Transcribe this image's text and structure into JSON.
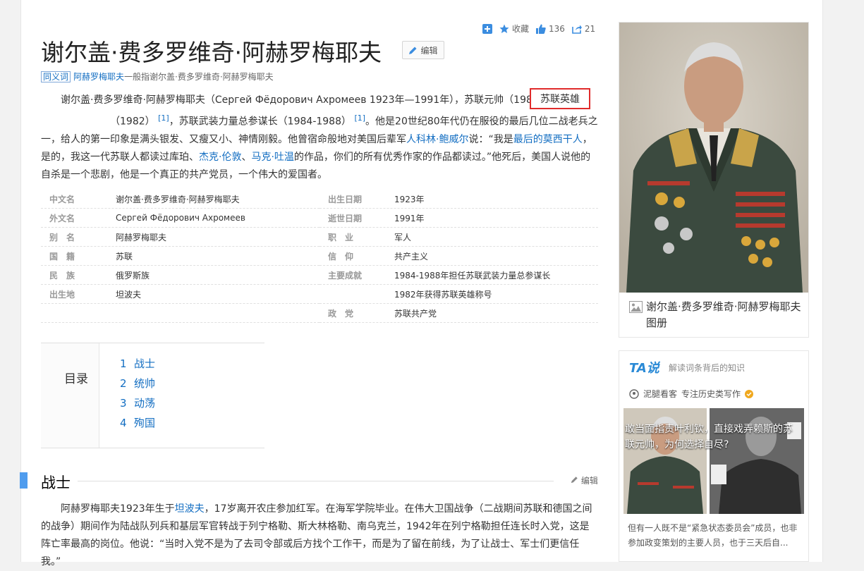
{
  "article": {
    "title": "谢尔盖·费多罗维奇·阿赫罗梅耶夫",
    "edit_label": "编辑",
    "toolbar": {
      "add": "",
      "favorite": "收藏",
      "like_count": "136",
      "share_count": "21"
    },
    "sense": {
      "tag": "同义词",
      "alias": "阿赫罗梅耶夫",
      "text": "一般指谢尔盖·费多罗维奇·阿赫罗梅耶夫"
    },
    "summary": {
      "p1_a": "谢尔盖·费多罗维奇·阿赫罗梅耶夫（Сергей Фёдорович Ахромеев 1923年—1991年），苏联元帅（1983）",
      "highlight": "苏联英雄",
      "p1_b": "（1982）",
      "ref1": "[1]",
      "p1_c": "，苏联武装力量总参谋长（1984-1988）",
      "ref2": "[1]",
      "p1_d": "。他是20世纪80年代仍在服役的最后几位二战老兵之一，给人的第一印象是满头银发、又瘦又小、神情刚毅。他曾宿命般地对美国后辈军",
      "link_a": "人科林·鲍威尔",
      "p1_e": "说：“我是",
      "link_b": "最后的莫西干人",
      "p1_f": "，是的，我这一代苏联人都读过库珀、",
      "link_c": "杰克·伦敦",
      "p1_g": "、",
      "link_d": "马克·吐温",
      "p1_h": "的作品，你们的所有优秀作家的作品都读过。”他死后，美国人说他的自杀是一个悲剧，他是一个真正的共产党员，一个伟大的爱国者。"
    },
    "basic_left": [
      {
        "k": "中文名",
        "v": "谢尔盖·费多罗维奇·阿赫罗梅耶夫"
      },
      {
        "k": "外文名",
        "v": "Сергей Фёдорович Ахромеев"
      },
      {
        "k": "别　名",
        "v": "阿赫罗梅耶夫"
      },
      {
        "k": "国　籍",
        "v": "苏联"
      },
      {
        "k": "民　族",
        "v": "俄罗斯族"
      },
      {
        "k": "出生地",
        "v": "坦波夫"
      },
      {
        "k": "",
        "v": ""
      }
    ],
    "basic_right": [
      {
        "k": "出生日期",
        "v": "1923年"
      },
      {
        "k": "逝世日期",
        "v": "1991年"
      },
      {
        "k": "职　业",
        "v": "军人"
      },
      {
        "k": "信　仰",
        "v": "共产主义"
      },
      {
        "k": "主要成就",
        "v": "1984-1988年担任苏联武装力量总参谋长"
      },
      {
        "k": "",
        "v": "1982年获得苏联英雄称号"
      },
      {
        "k": "政　党",
        "v": "苏联共产党"
      }
    ],
    "toc": {
      "title": "目录",
      "items": [
        {
          "n": "1",
          "label": "战士"
        },
        {
          "n": "2",
          "label": "统帅"
        },
        {
          "n": "3",
          "label": "动荡"
        },
        {
          "n": "4",
          "label": "殉国"
        }
      ]
    },
    "section1": {
      "title": "战士",
      "edit": "编辑",
      "p_a": "阿赫罗梅耶夫1923年生于",
      "link": "坦波夫",
      "p_b": "，17岁离开农庄参加红军。在海军学院毕业。在伟大卫国战争（二战期间苏联和德国之间的战争）期间作为陆战队列兵和基层军官转战于列宁格勒、斯大林格勒、南乌克兰，1942年在列宁格勒担任连长时入党，这是阵亡率最高的岗位。他说：“当时入党不是为了去司令部或后方找个工作干，而是为了留在前线，为了让战士、军士们更信任我。”"
    }
  },
  "sidebar": {
    "album_caption": "谢尔盖·费多罗维奇·阿赫罗梅耶夫图册",
    "ta": {
      "logo": "TA说",
      "subtitle": "解读词条背后的知识",
      "author": "泥腿看客",
      "author_desc": "专注历史类写作",
      "headline": "敢当面指责叶利钦，直接戏弄赖斯的苏联元帅，为何选择自尽?",
      "desc": "但有一人既不是“紧急状态委员会”成员，也非参加政变策划的主要人员，也于三天后自..."
    }
  }
}
